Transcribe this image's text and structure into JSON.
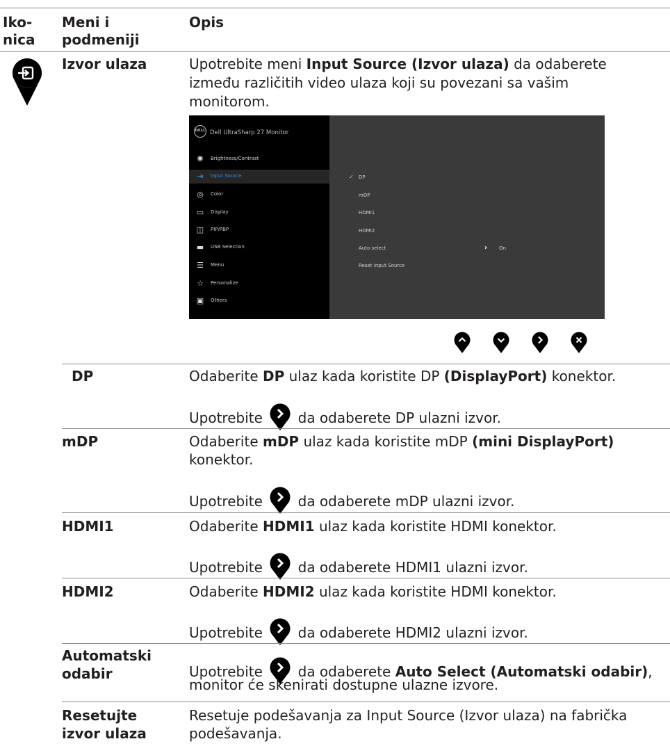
{
  "header": {
    "col1": "Iko-\nnica",
    "col1_line1": "Iko-",
    "col1_line2": "nica",
    "col2_line1": "Meni i",
    "col2_line2": "podmeniji",
    "col3": "Opis"
  },
  "main_row": {
    "icon": "input-source-icon",
    "title": "Izvor ulaza",
    "desc_pre": "Upotrebite meni ",
    "desc_bold": "Input Source (Izvor ulaza)",
    "desc_post": " da odaberete",
    "desc_line2": "između različitih video ulaza koji su povezani sa vašim",
    "desc_line3": "monitorom."
  },
  "osd": {
    "title": "Dell UltraSharp 27 Monitor",
    "logo": "DELL",
    "menu": [
      {
        "label": "Brightness/Contrast",
        "icon": "brightness-icon"
      },
      {
        "label": "Input Source",
        "icon": "input-source-icon",
        "active": true
      },
      {
        "label": "Color",
        "icon": "color-icon"
      },
      {
        "label": "Display",
        "icon": "display-icon"
      },
      {
        "label": "PIP/PBP",
        "icon": "pip-icon"
      },
      {
        "label": "USB Selection",
        "icon": "usb-icon"
      },
      {
        "label": "Menu",
        "icon": "menu-icon"
      },
      {
        "label": "Personalize",
        "icon": "star-icon"
      },
      {
        "label": "Others",
        "icon": "others-icon"
      }
    ],
    "options": [
      "DP",
      "mDP",
      "HDMI1",
      "HDMI2",
      "Auto select",
      "Reset Input Source"
    ],
    "selected": "DP",
    "auto_select_value": "On",
    "colors": {
      "left_panel": "#000000",
      "right_panel": "#3a3a3a",
      "accent": "#3b8fd6"
    }
  },
  "nav_buttons": [
    "up-icon",
    "down-icon",
    "right-icon",
    "close-icon"
  ],
  "rows": [
    {
      "name_line1": "DP",
      "name_line2": "",
      "line1_pre": "Odaberite ",
      "line1_bold": "DP",
      "line1_mid": " ulaz kada koristite DP ",
      "line1_bold2": "(DisplayPort)",
      "line1_post": " konektor.",
      "line2_pre": "Upotrebite",
      "line2_post": "da odaberete DP ulazni izvor."
    },
    {
      "name_line1": "mDP",
      "name_line2": "",
      "line1_pre": "Odaberite ",
      "line1_bold": "mDP",
      "line1_mid": " ulaz kada koristite mDP ",
      "line1_bold2": "(mini DisplayPort)",
      "line1_post": "",
      "line1b": "konektor.",
      "line2_pre": "Upotrebite",
      "line2_post": "da odaberete mDP ulazni izvor."
    },
    {
      "name_line1": "HDMI1",
      "name_line2": "",
      "line1_pre": "Odaberite ",
      "line1_bold": "HDMI1",
      "line1_mid": " ulaz kada koristite HDMI konektor.",
      "line1_bold2": "",
      "line1_post": "",
      "line2_pre": "Upotrebite",
      "line2_post": "da odaberete HDMI1 ulazni izvor."
    },
    {
      "name_line1": "HDMI2",
      "name_line2": "",
      "line1_pre": "Odaberite ",
      "line1_bold": "HDMI2",
      "line1_mid": " ulaz kada koristite HDMI konektor.",
      "line1_bold2": "",
      "line1_post": "",
      "line2_pre": "Upotrebite",
      "line2_post": "da odaberete HDMI2 ulazni izvor."
    }
  ],
  "auto_row": {
    "name_line1": "Automatski",
    "name_line2": "odabir",
    "pre": "Upotrebite",
    "mid": " da odaberete ",
    "bold": "Auto Select (Automatski odabir)",
    "post": ",",
    "line2": "monitor će skenirati dostupne ulazne izvore."
  },
  "reset_row": {
    "name_line1": "Resetujte",
    "name_line2": "izvor ulaza",
    "line1": "Resetuje podešavanja za Input Source (Izvor ulaza) na fabrička",
    "line2": "podešavanja."
  }
}
